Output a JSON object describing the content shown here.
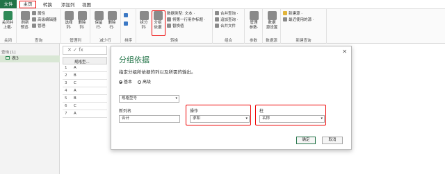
{
  "tabs": {
    "file": "文件",
    "home": "主页",
    "transform": "转换",
    "add_column": "添加列",
    "view": "视图"
  },
  "ribbon": {
    "close_apply": "关闭并\n上载·",
    "close_group": "关闭",
    "refresh": "刷新\n预览·",
    "properties": "属性",
    "advanced_editor": "高级编辑器",
    "manage": "管理·",
    "query_group": "查询",
    "choose_cols": "选择\n列·",
    "remove_cols": "删除\n列·",
    "manage_cols_group": "管理列",
    "keep_rows": "保留\n行·",
    "remove_rows": "删除\n行·",
    "reduce_rows_group": "减少行",
    "sort_group": "排序",
    "split_col": "拆分\n列·",
    "group_by": "分组\n依据",
    "data_type": "数据类型: 文本 ·",
    "use_first_row": "将第一行用作标题 ·",
    "replace_values": "替换值",
    "transform_group": "转换",
    "merge_queries": "合并查询 ·",
    "append_queries": "追加查询 ·",
    "combine_files": "合并文件",
    "combine_group": "组合",
    "manage_params": "管理\n参数·",
    "params_group": "参数",
    "ds_settings": "数据\n源设置",
    "ds_group": "数据源",
    "new_source": "新建源 ·",
    "recent_sources": "最近使用的源 ·",
    "new_query_group": "新建查询"
  },
  "queries": {
    "header": "查询 [1]",
    "item": "表3"
  },
  "formula_bar": {
    "placeholder": "fx"
  },
  "grid": {
    "col1": "规格型...",
    "rows": [
      {
        "n": "1",
        "v": "A"
      },
      {
        "n": "2",
        "v": "B"
      },
      {
        "n": "3",
        "v": "C"
      },
      {
        "n": "4",
        "v": "A"
      },
      {
        "n": "5",
        "v": "B"
      },
      {
        "n": "6",
        "v": "C"
      },
      {
        "n": "7",
        "v": "A"
      }
    ]
  },
  "dialog": {
    "title": "分组依据",
    "close": "✕",
    "description": "指定分组所依据的列以及所需的输出。",
    "radio_basic": "基本",
    "radio_advanced": "高级",
    "group_col": "规格型号",
    "new_col_label": "新列名",
    "new_col_value": "合计",
    "op_label": "操作",
    "op_value": "求和",
    "col_label": "柱",
    "col_value": "名称",
    "ok": "确定",
    "cancel": "取消"
  },
  "colors": {
    "accent": "#217346",
    "highlight": "#e00000"
  }
}
